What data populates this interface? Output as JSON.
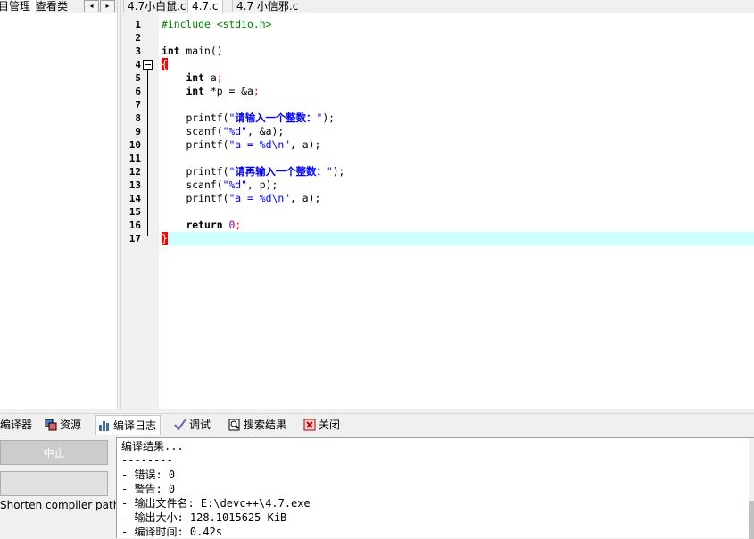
{
  "left_panel": {
    "tabs": [
      "项目管理",
      "查看类"
    ],
    "scroll_left": "◂",
    "scroll_right": "▸"
  },
  "editor_tabs": [
    "4.7小白鼠.c",
    "4.7.c",
    "4.7 小信邪.c"
  ],
  "editor": {
    "line_numbers": [
      "1",
      "2",
      "3",
      "4",
      "5",
      "6",
      "7",
      "8",
      "9",
      "10",
      "11",
      "12",
      "13",
      "14",
      "15",
      "16",
      "17"
    ],
    "lines": [
      {
        "pp": "#include <stdio.h>"
      },
      {},
      {
        "kw": "int",
        "rest": " main()"
      },
      {
        "brace": "{"
      },
      {
        "indent": "    ",
        "kw": "int",
        "rest": " a",
        "sym": ";"
      },
      {
        "indent": "    ",
        "kw": "int",
        "rest": " *p = &a",
        "sym": ";"
      },
      {},
      {
        "indent": "    ",
        "rest": "printf(",
        "str1": "\"",
        "zh": "请输入一个整数：",
        "str2": "\"",
        "tail": ");"
      },
      {
        "indent": "    ",
        "rest": "scanf(",
        "str1": "\"%d\"",
        "tail": ", &a);"
      },
      {
        "indent": "    ",
        "rest": "printf(",
        "str1": "\"a = %d\\n\"",
        "tail": ", a);"
      },
      {},
      {
        "indent": "    ",
        "rest": "printf(",
        "str1": "\"",
        "zh": "请再输入一个整数：",
        "str2": "\"",
        "tail": ");"
      },
      {
        "indent": "    ",
        "rest": "scanf(",
        "str1": "\"%d\"",
        "tail": ", p);"
      },
      {
        "indent": "    ",
        "rest": "printf(",
        "str1": "\"a = %d\\n\"",
        "tail": ", a);"
      },
      {},
      {
        "indent": "    ",
        "kw": "return",
        "rest": " ",
        "num": "0",
        "sym": ";"
      },
      {
        "brace": "}"
      }
    ],
    "current_line": 17
  },
  "bottom_tabs": [
    "编译器",
    "资源",
    "编译日志",
    "调试",
    "搜索结果",
    "关闭"
  ],
  "bottom_tab_icons": [
    "compiler-icon",
    "resources-icon",
    "compile-log-icon",
    "debug-icon",
    "search-results-icon",
    "close-icon"
  ],
  "bottom_left": {
    "abort_label": "中止",
    "shorten_label": "Shorten compiler paths"
  },
  "log_lines": [
    "编译结果...",
    "--------",
    "- 错误: 0",
    "- 警告: 0",
    "- 输出文件名: E:\\devc++\\4.7.exe",
    "- 输出大小: 128.1015625 KiB",
    "- 编译时间: 0.42s"
  ],
  "colors": {
    "keyword": "#000000",
    "preprocessor": "#008000",
    "string": "#0000ff",
    "symbol": "#ff0000",
    "number": "#800080",
    "current_line_bg": "#ccffff",
    "brace_match_bg": "#ff0000"
  }
}
